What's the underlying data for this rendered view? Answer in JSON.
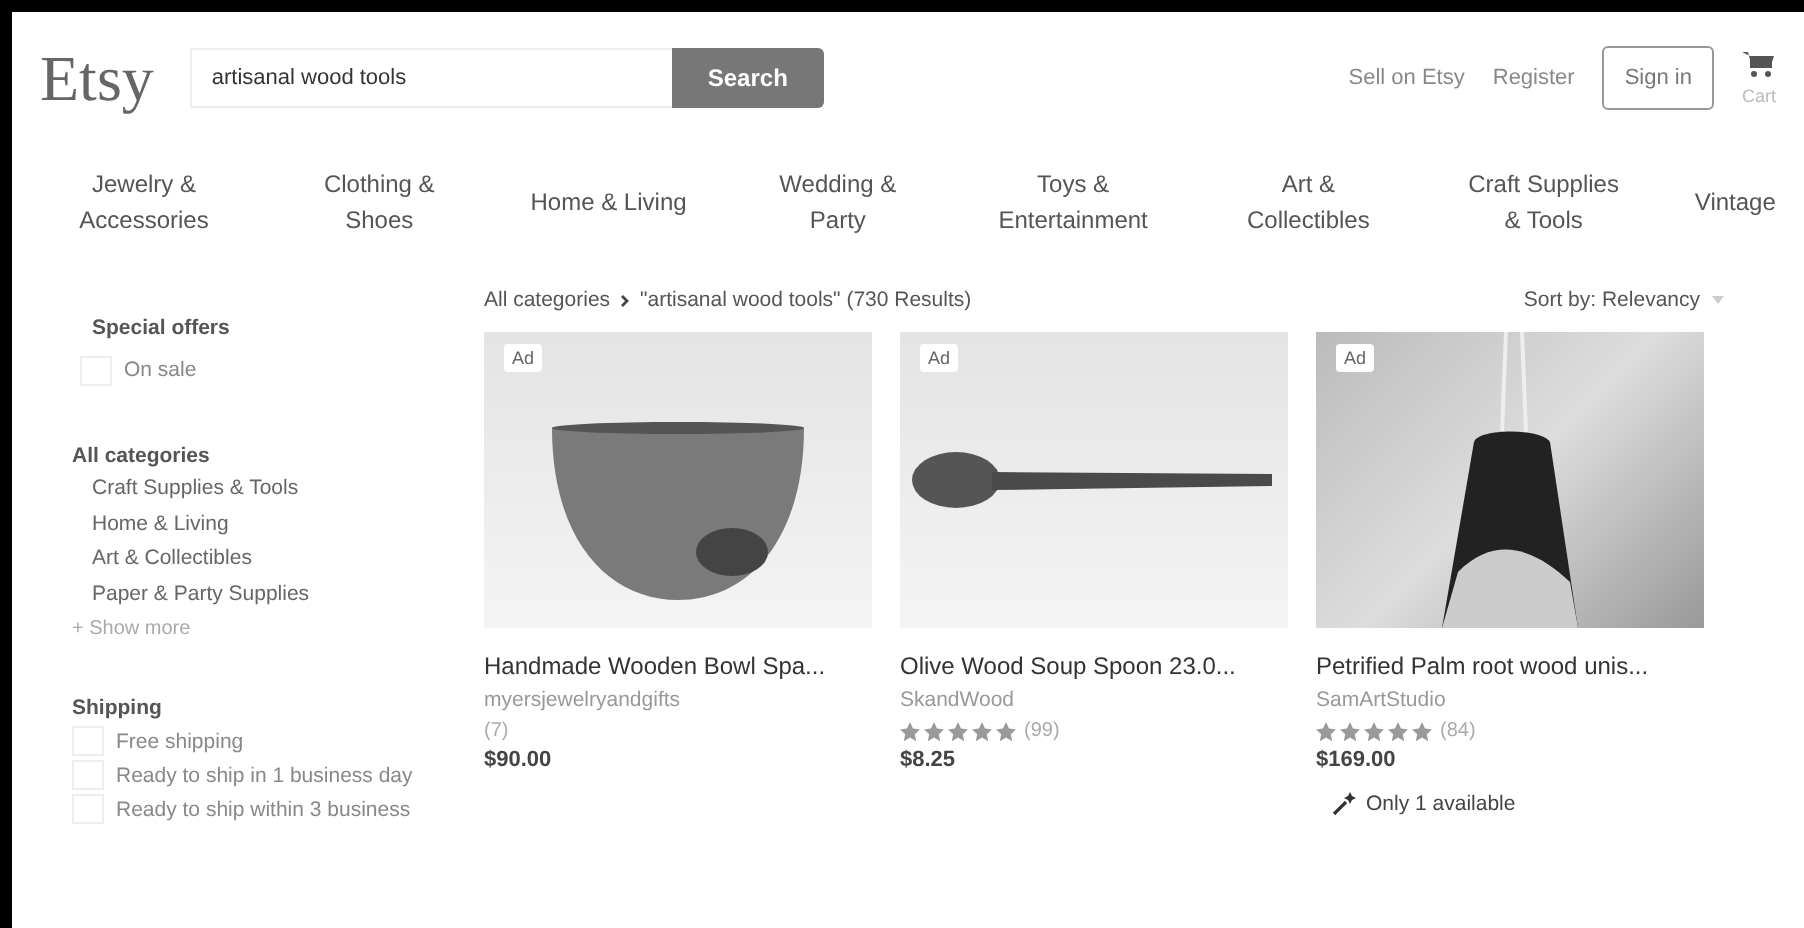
{
  "header": {
    "logo": "Etsy",
    "search": {
      "value": "artisanal wood tools",
      "button": "Search"
    },
    "links": [
      "Sell on Etsy",
      "Register"
    ],
    "sign_in": "Sign in",
    "cart": "Cart"
  },
  "categories": [
    "Jewelry & Accessories",
    "Clothing & Shoes",
    "Home & Living",
    "Wedding & Party",
    "Toys & Entertainment",
    "Art & Collectibles",
    "Craft Supplies & Tools",
    "Vintage"
  ],
  "sidebar": {
    "special_offers": {
      "title": "Special offers",
      "options": [
        {
          "label": "On sale",
          "checked": false
        }
      ]
    },
    "all_categories": {
      "title": "All categories",
      "items": [
        "Craft Supplies & Tools",
        "Home & Living",
        "Art & Collectibles",
        "Paper & Party Supplies"
      ],
      "show_more": "+ Show more"
    },
    "shipping": {
      "title": "Shipping",
      "options": [
        {
          "label": "Free shipping",
          "checked": false
        },
        {
          "label": "Ready to ship in 1 business day",
          "checked": false
        },
        {
          "label": "Ready to ship within 3 business",
          "checked": false
        }
      ]
    }
  },
  "results": {
    "breadcrumb_root": "All categories",
    "breadcrumb_query": "\"artisanal wood tools\" (730 Results)",
    "sort": "Sort by: Relevancy",
    "products": [
      {
        "kind": "bowl",
        "badge": "Ad",
        "title": "Handmade Wooden Bowl Spa...",
        "shop": "myersjewelryandgifts",
        "reviews": "(7)",
        "price": "$90.00"
      },
      {
        "kind": "spoon",
        "badge": "Ad",
        "title": "Olive Wood Soup Spoon 23.0...",
        "shop": "SkandWood",
        "stars": 5,
        "reviews": "(99)",
        "price": "$8.25"
      },
      {
        "kind": "pendant",
        "badge": "Ad",
        "title": "Petrified Palm root wood unis...",
        "shop": "SamArtStudio",
        "stars": 5,
        "reviews": "(84)",
        "price": "$169.00",
        "note": "Only 1 available"
      }
    ]
  }
}
